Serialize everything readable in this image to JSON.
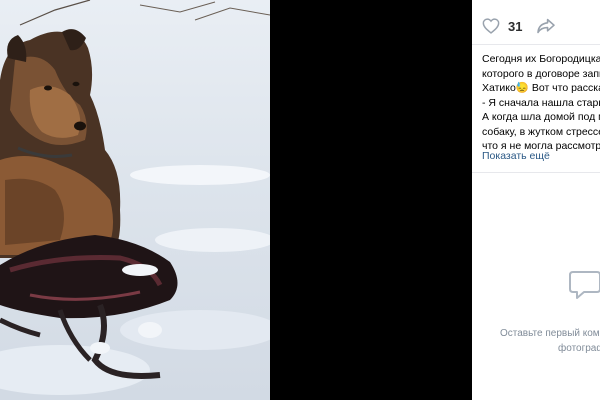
{
  "post": {
    "likes": "31",
    "text_lines": [
      "Сегодня их Богородицка",
      "которого в договоре запи",
      "Хатико😓 Вот что расска",
      "- Я сначала нашла старый",
      "А когда шла домой под м",
      "собаку, в жутком стрессе",
      "что я не могла рассмотре"
    ],
    "show_more": "Показать ещё"
  },
  "comments": {
    "empty_line1": "Оставьте первый ком",
    "empty_line2": "фотограф"
  },
  "icons": {
    "like": "heart-icon",
    "share": "share-arrow-icon",
    "comments": "comment-bubble-icon"
  },
  "colors": {
    "link": "#2a5885",
    "muted": "#818c99",
    "icon": "#99a2ad",
    "viewer_bg": "#000000"
  }
}
